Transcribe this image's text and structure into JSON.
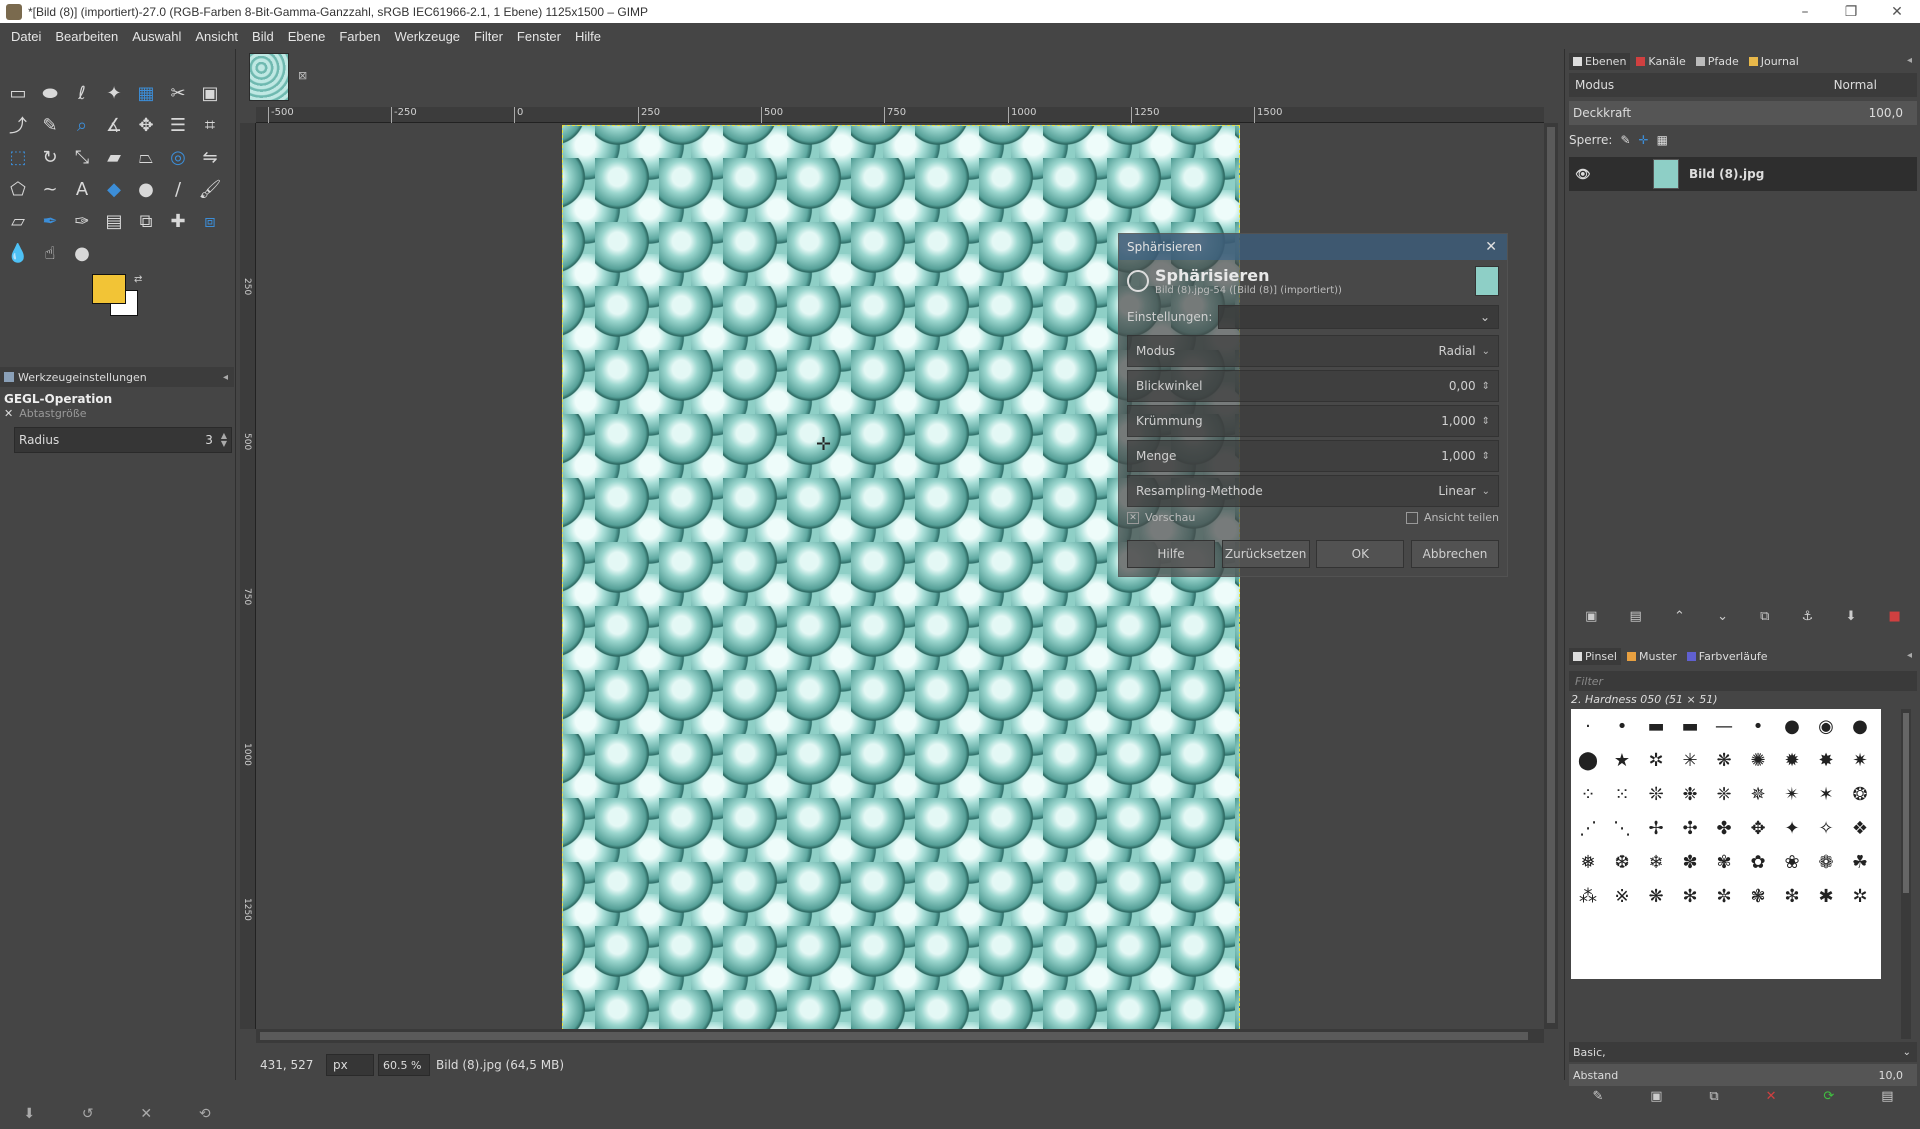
{
  "window": {
    "title": "*[Bild (8)] (importiert)-27.0 (RGB-Farben 8-Bit-Gamma-Ganzzahl, sRGB IEC61966-2.1, 1 Ebene) 1125x1500 – GIMP",
    "minimize": "–",
    "maximize": "❐",
    "close": "✕"
  },
  "menu": [
    "Datei",
    "Bearbeiten",
    "Auswahl",
    "Ansicht",
    "Bild",
    "Ebene",
    "Farben",
    "Werkzeuge",
    "Filter",
    "Fenster",
    "Hilfe"
  ],
  "toolbox": {
    "tools": [
      {
        "name": "rect-select-icon",
        "glyph": "▭"
      },
      {
        "name": "ellipse-select-icon",
        "glyph": "⬬"
      },
      {
        "name": "lasso-icon",
        "glyph": "ℓ"
      },
      {
        "name": "fuzzy-select-icon",
        "glyph": "✦"
      },
      {
        "name": "select-by-color-icon",
        "glyph": "▦"
      },
      {
        "name": "scissors-icon",
        "glyph": "✂"
      },
      {
        "name": "foreground-select-icon",
        "glyph": "▣"
      },
      {
        "name": "paths-icon",
        "glyph": "⤴"
      },
      {
        "name": "color-picker-icon",
        "glyph": "✎"
      },
      {
        "name": "zoom-icon",
        "glyph": "⌕"
      },
      {
        "name": "measure-icon",
        "glyph": "∡"
      },
      {
        "name": "move-icon",
        "glyph": "✥"
      },
      {
        "name": "align-icon",
        "glyph": "☰"
      },
      {
        "name": "crop-icon",
        "glyph": "⌗"
      },
      {
        "name": "unified-transform-icon",
        "glyph": "⬚"
      },
      {
        "name": "rotate-icon",
        "glyph": "↻"
      },
      {
        "name": "scale-icon",
        "glyph": "⤡"
      },
      {
        "name": "shear-icon",
        "glyph": "▰"
      },
      {
        "name": "perspective-icon",
        "glyph": "⏢"
      },
      {
        "name": "3d-transform-icon",
        "glyph": "◎"
      },
      {
        "name": "flip-icon",
        "glyph": "⇋"
      },
      {
        "name": "cage-icon",
        "glyph": "⬠"
      },
      {
        "name": "warp-icon",
        "glyph": "~"
      },
      {
        "name": "text-icon",
        "glyph": "A"
      },
      {
        "name": "bucket-fill-icon",
        "glyph": "◆"
      },
      {
        "name": "gradient-icon",
        "glyph": "●"
      },
      {
        "name": "pencil-icon",
        "glyph": "/"
      },
      {
        "name": "paintbrush-icon",
        "glyph": "🖌"
      },
      {
        "name": "eraser-icon",
        "glyph": "▱"
      },
      {
        "name": "airbrush-icon",
        "glyph": "✒"
      },
      {
        "name": "ink-icon",
        "glyph": "✑"
      },
      {
        "name": "mypaint-icon",
        "glyph": "▤"
      },
      {
        "name": "clone-icon",
        "glyph": "⧉"
      },
      {
        "name": "heal-icon",
        "glyph": "✚"
      },
      {
        "name": "perspective-clone-icon",
        "glyph": "⧈"
      },
      {
        "name": "blur-icon",
        "glyph": "💧"
      },
      {
        "name": "smudge-icon",
        "glyph": "☝"
      },
      {
        "name": "dodge-burn-icon",
        "glyph": "●"
      }
    ],
    "options_tab": "Werkzeugeinstellungen",
    "gegl_title": "GEGL-Operation",
    "sample_size": "Abtastgröße",
    "radius_label": "Radius",
    "radius_value": "3"
  },
  "ruler": {
    "h_ticks": [
      "-500",
      "-250",
      "0",
      "250",
      "500",
      "750",
      "1000",
      "1250",
      "1500"
    ],
    "v_ticks": [
      "250",
      "500",
      "750",
      "1000",
      "1250"
    ]
  },
  "status": {
    "coords": "431, 527",
    "unit": "px",
    "zoom": "60.5 %",
    "file": "Bild (8).jpg (64,5 MB)"
  },
  "dialog": {
    "title": "Sphärisieren",
    "heading": "Sphärisieren",
    "subheading": "Bild (8).jpg-54 ([Bild (8)] (importiert))",
    "settings_label": "Einstellungen:",
    "fields": [
      {
        "label": "Modus",
        "value": "Radial",
        "type": "combo"
      },
      {
        "label": "Blickwinkel",
        "value": "0,00",
        "type": "spin"
      },
      {
        "label": "Krümmung",
        "value": "1,000",
        "type": "spin"
      },
      {
        "label": "Menge",
        "value": "1,000",
        "type": "spin"
      },
      {
        "label": "Resampling-Methode",
        "value": "Linear",
        "type": "combo"
      }
    ],
    "preview": "Vorschau",
    "split_view": "Ansicht teilen",
    "buttons": [
      "Hilfe",
      "Zurücksetzen",
      "OK",
      "Abbrechen"
    ]
  },
  "layers": {
    "tabs": [
      "Ebenen",
      "Kanäle",
      "Pfade",
      "Journal"
    ],
    "mode_label": "Modus",
    "mode_value": "Normal",
    "opacity_label": "Deckkraft",
    "opacity_value": "100,0",
    "lock_label": "Sperre:",
    "layer_name": "Bild (8).jpg"
  },
  "brushes": {
    "tabs": [
      "Pinsel",
      "Muster",
      "Farbverläufe"
    ],
    "filter_placeholder": "Filter",
    "current": "2. Hardness 050 (51 × 51)",
    "preset": "Basic,",
    "spacing_label": "Abstand",
    "spacing_value": "10,0"
  },
  "colors": {
    "fg": "#f2c436",
    "bg": "#ffffff",
    "accent": "#3c8ed8"
  }
}
